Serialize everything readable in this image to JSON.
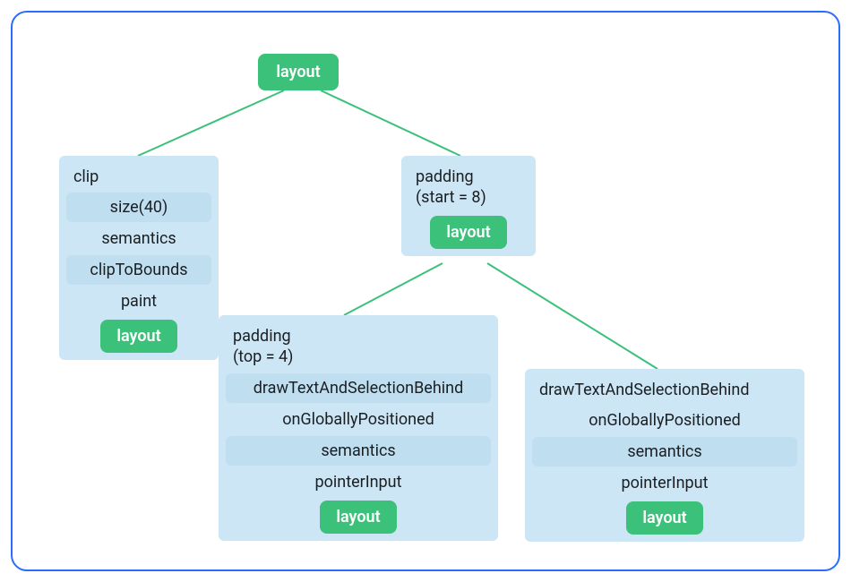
{
  "root": {
    "label": "layout"
  },
  "leftBox": {
    "clip": "clip",
    "size": "size(40)",
    "semantics": "semantics",
    "clipToBounds": "clipToBounds",
    "paint": "paint",
    "layout": "layout"
  },
  "midBox": {
    "paddingLine1": "padding",
    "paddingLine2": "(start = 8)",
    "layout": "layout"
  },
  "botLeft": {
    "paddingLine1": "padding",
    "paddingLine2": "(top = 4)",
    "draw": "drawTextAndSelectionBehind",
    "ogp": "onGloballyPositioned",
    "semantics": "semantics",
    "pointer": "pointerInput",
    "layout": "layout"
  },
  "botRight": {
    "draw": "drawTextAndSelectionBehind",
    "ogp": "onGloballyPositioned",
    "semantics": "semantics",
    "pointer": "pointerInput",
    "layout": "layout"
  }
}
